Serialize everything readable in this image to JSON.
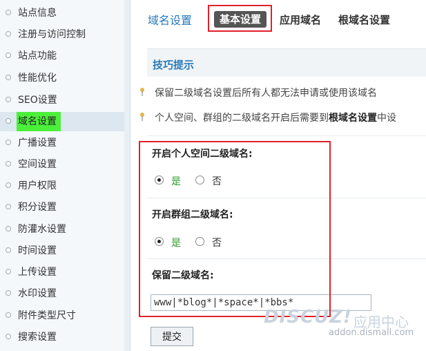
{
  "sidebar": {
    "items": [
      {
        "label": "站点信息",
        "active": false
      },
      {
        "label": "注册与访问控制",
        "active": false
      },
      {
        "label": "站点功能",
        "active": false
      },
      {
        "label": "性能优化",
        "active": false
      },
      {
        "label": "SEO设置",
        "active": false
      },
      {
        "label": "域名设置",
        "active": true
      },
      {
        "label": "广播设置",
        "active": false
      },
      {
        "label": "空间设置",
        "active": false
      },
      {
        "label": "用户权限",
        "active": false
      },
      {
        "label": "积分设置",
        "active": false
      },
      {
        "label": "防灌水设置",
        "active": false
      },
      {
        "label": "时间设置",
        "active": false
      },
      {
        "label": "上传设置",
        "active": false
      },
      {
        "label": "水印设置",
        "active": false
      },
      {
        "label": "附件类型尺寸",
        "active": false
      },
      {
        "label": "搜索设置",
        "active": false
      }
    ]
  },
  "header": {
    "title": "域名设置",
    "tabs": [
      {
        "label": "基本设置",
        "active": true
      },
      {
        "label": "应用域名",
        "active": false
      },
      {
        "label": "根域名设置",
        "active": false
      }
    ]
  },
  "tips": {
    "title": "技巧提示",
    "items": [
      {
        "text": "保留二级域名设置后所有人都无法申请或使用该域名"
      },
      {
        "prefix": "个人空间、群组的二级域名开启后需要到",
        "bold": "根域名设置",
        "suffix": "中设"
      }
    ]
  },
  "settings": {
    "home_subdomain": {
      "label": "开启个人空间二级域名:",
      "yes": "是",
      "no": "否",
      "value": "yes"
    },
    "group_subdomain": {
      "label": "开启群组二级域名:",
      "yes": "是",
      "no": "否",
      "value": "yes"
    },
    "reserved": {
      "label": "保留二级域名:",
      "value": "www|*blog*|*space*|*bbs*"
    }
  },
  "submit_label": "提交",
  "watermark": {
    "logo": "DISCUZ!",
    "app": "应用中心",
    "url": "addon.dismall.com"
  },
  "colors": {
    "accent": "#2a7ab8",
    "highlight": "#e0202a",
    "active_nav": "#4cf03a",
    "yes_text": "#2a9a2a"
  }
}
